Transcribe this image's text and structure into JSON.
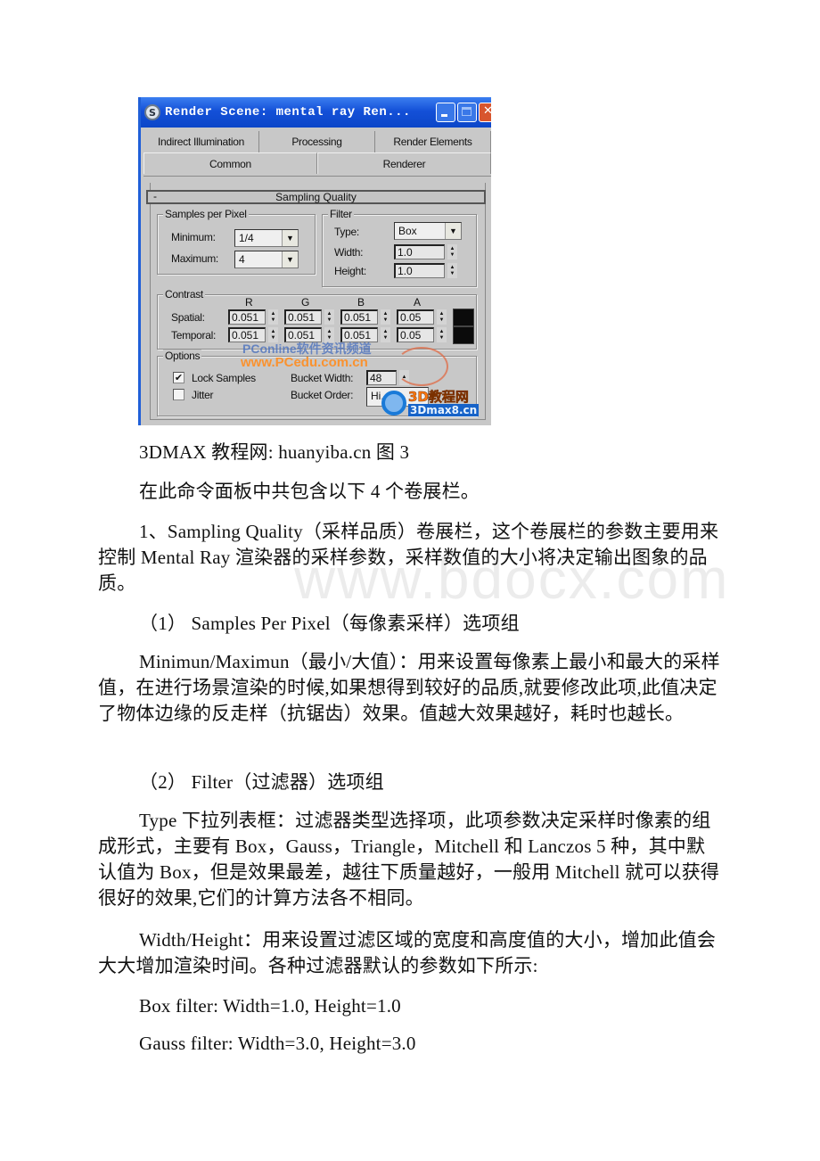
{
  "dialog": {
    "title": "Render Scene: mental ray Ren...",
    "app_icon": "3dsmax-logo-icon",
    "window_buttons": [
      "minimize",
      "maximize",
      "close"
    ],
    "tabs_row1": [
      "Indirect Illumination",
      "Processing",
      "Render Elements"
    ],
    "tabs_row2": [
      "Common",
      "Renderer"
    ],
    "active_tab": "Renderer",
    "rollout": {
      "toggle": "-",
      "title": "Sampling Quality"
    },
    "samples_per_pixel": {
      "label": "Samples per Pixel",
      "minimum_label": "Minimum:",
      "minimum_value": "1/4",
      "maximum_label": "Maximum:",
      "maximum_value": "4"
    },
    "filter": {
      "label": "Filter",
      "type_label": "Type:",
      "type_value": "Box",
      "width_label": "Width:",
      "width_value": "1.0",
      "height_label": "Height:",
      "height_value": "1.0"
    },
    "contrast": {
      "label": "Contrast",
      "columns": [
        "R",
        "G",
        "B",
        "A"
      ],
      "spatial_label": "Spatial:",
      "spatial_values": [
        "0.051",
        "0.051",
        "0.051",
        "0.05"
      ],
      "temporal_label": "Temporal:",
      "temporal_values": [
        "0.051",
        "0.051",
        "0.051",
        "0.05"
      ],
      "swatch_color": "#0b0b0b"
    },
    "options": {
      "label": "Options",
      "lock_samples_label": "Lock Samples",
      "lock_samples_checked": true,
      "jitter_label": "Jitter",
      "jitter_checked": false,
      "bucket_width_label": "Bucket Width:",
      "bucket_width_value": "48",
      "bucket_order_label": "Bucket Order:",
      "bucket_order_value": "Hi..."
    },
    "watermarks": {
      "pconline": "PConline软件资讯频道",
      "pcedu": "www.PCedu.com.cn",
      "logo_top": "3D教程网",
      "logo_bottom": "3Dmax8.cn"
    }
  },
  "document": {
    "caption": "3DMAX 教程网: huanyiba.cn 图 3",
    "intro": "在此命令面板中共包含以下 4 个卷展栏。",
    "para1": "1、Sampling Quality（采样品质）卷展栏，这个卷展栏的参数主要用来控制 Mental Ray 渲染器的采样参数，采样数值的大小将决定输出图象的品质。",
    "heading1": "（1） Samples Per Pixel（每像素采样）选项组",
    "para2": "Minimun/Maximun（最小/大值）：用来设置每像素上最小和最大的采样值，在进行场景渲染的时候,如果想得到较好的品质,就要修改此项,此值决定了物体边缘的反走样（抗锯齿）效果。值越大效果越好，耗时也越长。",
    "heading2": "（2） Filter（过滤器）选项组",
    "para3": "Type 下拉列表框：过滤器类型选择项，此项参数决定采样时像素的组成形式，主要有 Box，Gauss，Triangle，Mitchell 和 Lanczos 5 种，其中默认值为 Box，但是效果最差，越往下质量越好，一般用 Mitchell 就可以获得很好的效果,它们的计算方法各不相同。",
    "para4": "Width/Height：用来设置过滤区域的宽度和高度值的大小，增加此值会大大增加渲染时间。各种过滤器默认的参数如下所示:",
    "line_box": "Box filter: Width=1.0, Height=1.0",
    "line_gauss": "Gauss filter: Width=3.0, Height=3.0",
    "watermark": "www.bdocx.com"
  }
}
